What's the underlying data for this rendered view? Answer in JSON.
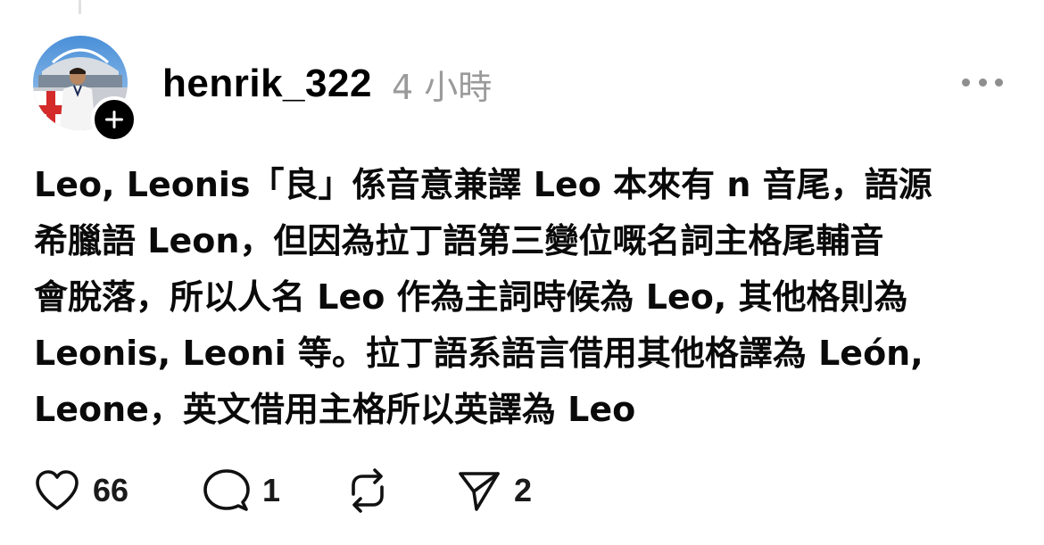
{
  "post": {
    "username": "henrik_322",
    "timestamp": "4 小時",
    "body_lines": [
      "Leo, Leonis「良」係音意兼譯 Leo 本來有 n 音尾，語源",
      "希臘語 Leon，但因為拉丁語第三變位嘅名詞主格尾輔音",
      "會脫落，所以人名 Leo 作為主詞時候為 Leo, 其他格則為",
      " Leonis, Leoni 等。拉丁語系語言借用其他格譯為 León,",
      "Leone，英文借用主格所以英譯為 Leo"
    ]
  },
  "actions": {
    "likes": "66",
    "replies": "1",
    "reposts": "",
    "shares": "2"
  },
  "icons": {
    "follow": "plus-icon",
    "more": "more-dots-icon",
    "like": "heart-icon",
    "reply": "comment-bubble-icon",
    "repost": "repost-arrows-icon",
    "share": "send-icon"
  },
  "colors": {
    "text": "#000000",
    "muted": "#9a9a9a",
    "badge": "#000000"
  }
}
